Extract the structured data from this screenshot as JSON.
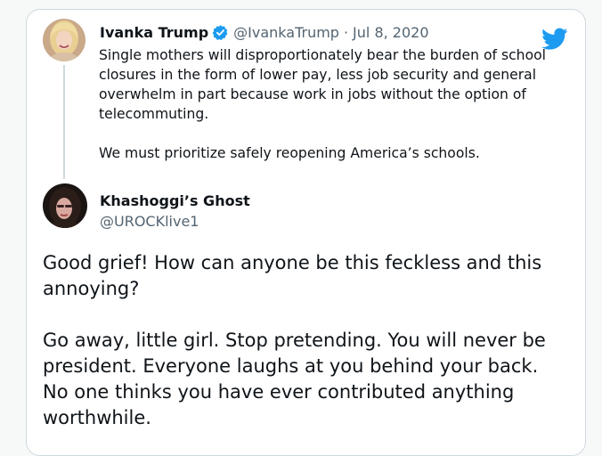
{
  "quoted_tweet": {
    "author_name": "Ivanka Trump",
    "author_handle": "@IvankaTrump",
    "separator": "·",
    "date": "Jul 8, 2020",
    "verified_icon": "verified-badge-icon",
    "paragraphs": [
      "Single mothers will disproportionately bear the burden of school closures in the form of lower pay, less job security and general overwhelm in part because work in jobs without the option of telecommuting.",
      "We must prioritize safely reopening America’s schools."
    ]
  },
  "reply_tweet": {
    "author_name": "Khashoggi’s Ghost",
    "author_handle": "@UROCKlive1",
    "paragraphs": [
      "Good grief! How can anyone be this feckless and this annoying?",
      "Go away, little girl. Stop pretending. You will never be president. Everyone laughs at you behind your back. No one thinks you have ever contributed anything worthwhile."
    ]
  },
  "icons": {
    "brand": "twitter-bird-icon"
  },
  "colors": {
    "brand_blue": "#1d9bf0",
    "text": "#0f1419",
    "secondary_text": "#536471",
    "border": "#cfd9de"
  }
}
